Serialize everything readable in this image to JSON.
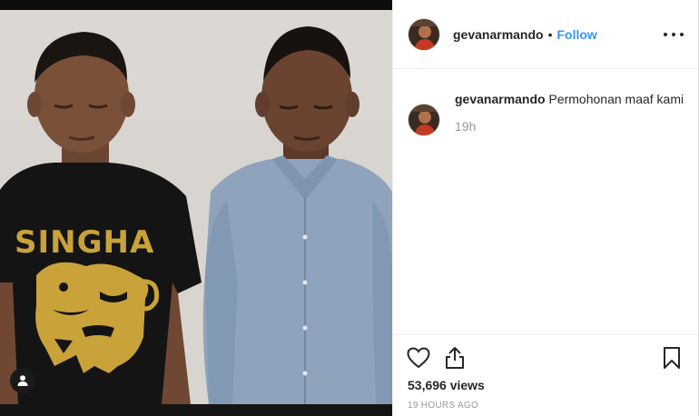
{
  "post": {
    "username": "gevanarmando",
    "separator": "•",
    "follow_label": "Follow",
    "caption_username": "gevanarmando",
    "caption_text": "Permohonan maaf kami",
    "relative_time": "19h",
    "views": "53,696 views",
    "posted_at": "19 HOURS AGO"
  },
  "media": {
    "shirt_print": "SINGHA"
  },
  "icons": {
    "user_tag": "user-icon",
    "options": "more-options-icon",
    "like": "heart-icon",
    "share": "share-icon",
    "save": "bookmark-icon"
  },
  "colors": {
    "link_blue": "#3897f0",
    "text_primary": "#262626",
    "text_secondary": "#999999",
    "border": "#efefef"
  }
}
